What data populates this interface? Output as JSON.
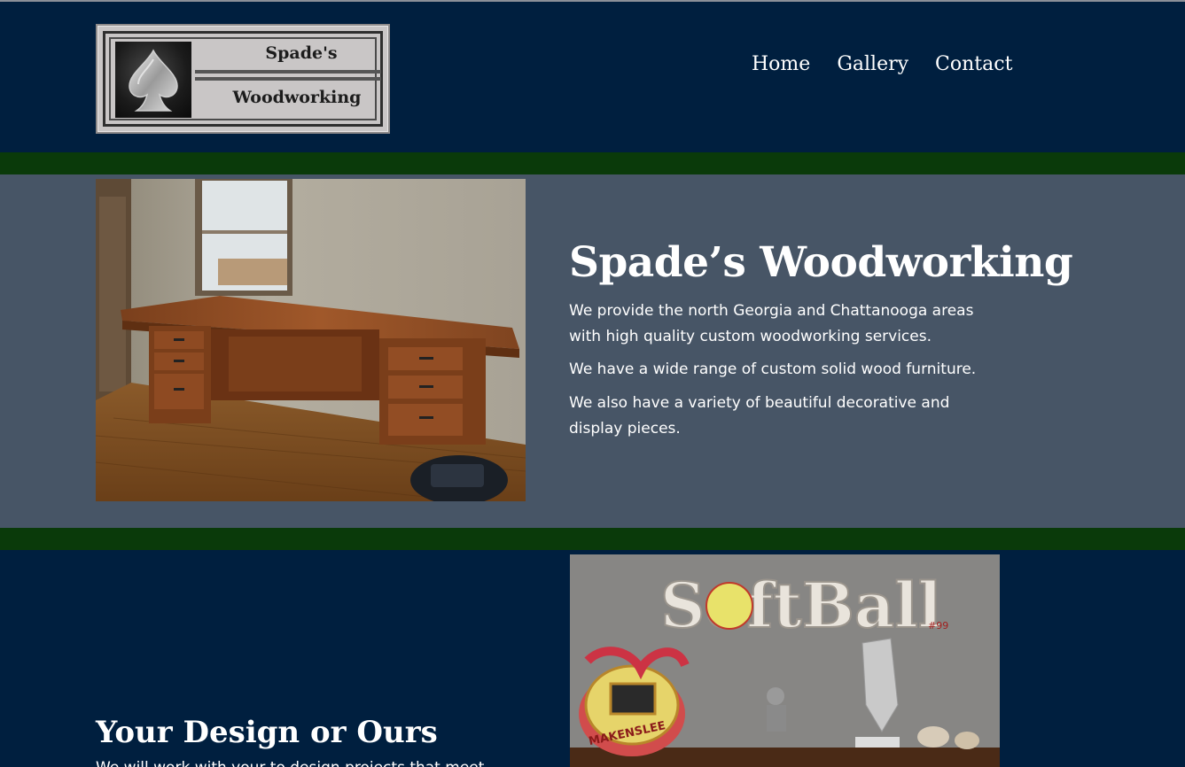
{
  "logo": {
    "line1": "Spade's",
    "line2": "Woodworking",
    "icon": "spade-icon"
  },
  "nav": {
    "items": [
      {
        "label": "Home"
      },
      {
        "label": "Gallery"
      },
      {
        "label": "Contact"
      }
    ]
  },
  "hero": {
    "title": "Spade’s Woodworking",
    "paragraphs": [
      "We provide the north Georgia and Chattanooga areas with high quality custom woodworking services.",
      "We have a wide range of custom solid wood furniture.",
      "We also have a variety of beautiful decorative and display pieces."
    ],
    "image_desc": "custom wooden desk photo"
  },
  "second": {
    "title": "Your Design or Ours",
    "text": "We will work with your to design projects that meet",
    "image_sign_text": "SoftBall",
    "image_sign_number": "#99",
    "image_badge_text": "MAKENSLEE"
  },
  "colors": {
    "header_bg": "#001f3f",
    "green_band": "#0a3a0a",
    "hero_bg": "#475566"
  }
}
